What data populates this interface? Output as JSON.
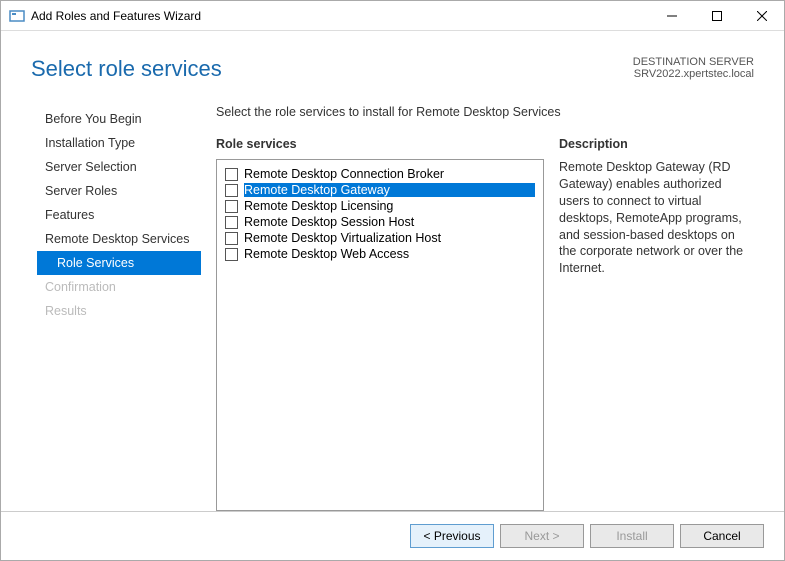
{
  "titlebar": {
    "title": "Add Roles and Features Wizard"
  },
  "header": {
    "title": "Select role services",
    "destination_label": "DESTINATION SERVER",
    "server_name": "SRV2022.xpertstec.local"
  },
  "sidebar": {
    "items": [
      {
        "label": "Before You Begin",
        "selected": false,
        "disabled": false,
        "sub": false
      },
      {
        "label": "Installation Type",
        "selected": false,
        "disabled": false,
        "sub": false
      },
      {
        "label": "Server Selection",
        "selected": false,
        "disabled": false,
        "sub": false
      },
      {
        "label": "Server Roles",
        "selected": false,
        "disabled": false,
        "sub": false
      },
      {
        "label": "Features",
        "selected": false,
        "disabled": false,
        "sub": false
      },
      {
        "label": "Remote Desktop Services",
        "selected": false,
        "disabled": false,
        "sub": false
      },
      {
        "label": "Role Services",
        "selected": true,
        "disabled": false,
        "sub": true
      },
      {
        "label": "Confirmation",
        "selected": false,
        "disabled": true,
        "sub": false
      },
      {
        "label": "Results",
        "selected": false,
        "disabled": true,
        "sub": false
      }
    ]
  },
  "main": {
    "instruction": "Select the role services to install for Remote Desktop Services",
    "services_header": "Role services",
    "description_header": "Description",
    "services": [
      {
        "label": "Remote Desktop Connection Broker",
        "checked": false,
        "selected": false
      },
      {
        "label": "Remote Desktop Gateway",
        "checked": false,
        "selected": true
      },
      {
        "label": "Remote Desktop Licensing",
        "checked": false,
        "selected": false
      },
      {
        "label": "Remote Desktop Session Host",
        "checked": false,
        "selected": false
      },
      {
        "label": "Remote Desktop Virtualization Host",
        "checked": false,
        "selected": false
      },
      {
        "label": "Remote Desktop Web Access",
        "checked": false,
        "selected": false
      }
    ],
    "description_text": "Remote Desktop Gateway (RD Gateway) enables authorized users to connect to virtual desktops, RemoteApp programs, and session-based desktops on the corporate network or over the Internet."
  },
  "footer": {
    "previous": "< Previous",
    "next": "Next >",
    "install": "Install",
    "cancel": "Cancel"
  }
}
